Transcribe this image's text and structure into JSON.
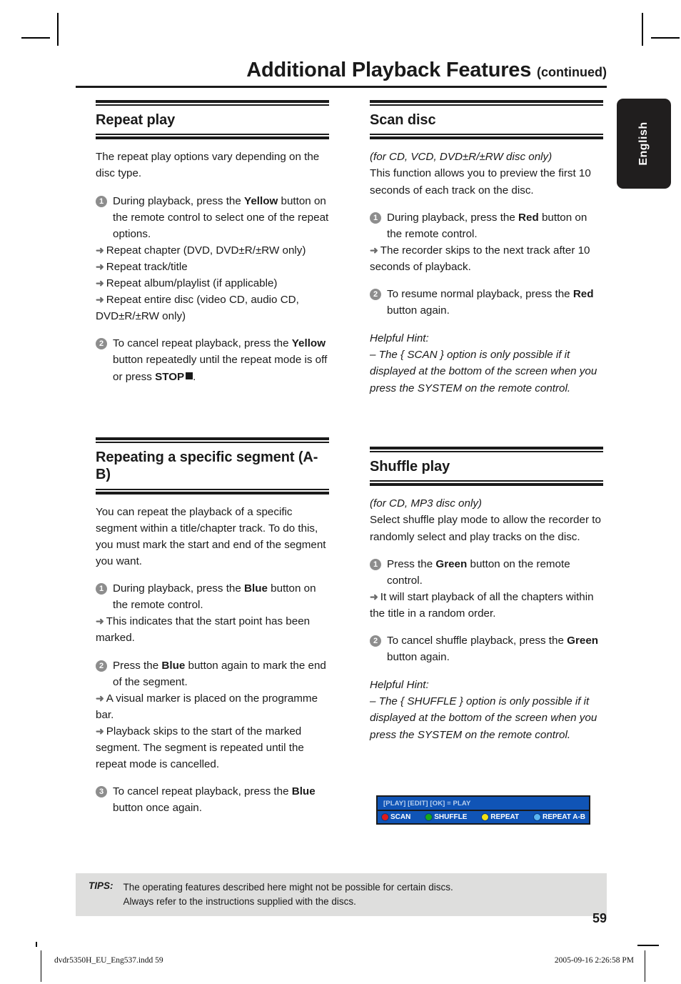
{
  "header": {
    "title_main": "Additional Playback Features",
    "title_suffix": "(continued)"
  },
  "language_tab": {
    "label": "English"
  },
  "left_column": {
    "sections": [
      {
        "heading": "Repeat play",
        "intro": "The repeat play options vary depending on the disc type.",
        "steps": [
          {
            "number": "1",
            "text_parts": [
              {
                "t": "During playback, press the ",
                "style": "normal"
              },
              {
                "t": "Yellow",
                "style": "bold"
              },
              {
                "t": " button on the remote control to select one of the repeat options.",
                "style": "normal"
              }
            ],
            "subs": [
              "Repeat chapter (DVD, DVD±R/±RW only)",
              "Repeat track/title",
              "Repeat album/playlist (if applicable)",
              "Repeat entire disc (video CD, audio CD, DVD±R/±RW only)"
            ]
          },
          {
            "number": "2",
            "text_parts": [
              {
                "t": "To cancel repeat playback, press the ",
                "style": "normal"
              },
              {
                "t": "Yellow",
                "style": "bold"
              },
              {
                "t": " button repeatedly until the repeat mode is off or press ",
                "style": "normal"
              },
              {
                "t": "STOP",
                "style": "bold"
              },
              {
                "t": "STOP_SQUARE",
                "style": "icon"
              },
              {
                "t": ".",
                "style": "normal"
              }
            ],
            "subs": []
          }
        ]
      },
      {
        "heading": "Repeating a specific segment (A-B)",
        "intro": "You can repeat the playback of a specific segment within a title/chapter track. To do this, you must mark the start and end of the segment you want.",
        "steps": [
          {
            "number": "1",
            "text_parts": [
              {
                "t": "During playback, press the ",
                "style": "normal"
              },
              {
                "t": "Blue",
                "style": "bold"
              },
              {
                "t": " button on the remote control.",
                "style": "normal"
              }
            ],
            "subs": [
              "This indicates that the start point has been marked."
            ]
          },
          {
            "number": "2",
            "text_parts": [
              {
                "t": "Press the ",
                "style": "normal"
              },
              {
                "t": "Blue",
                "style": "bold"
              },
              {
                "t": " button again to mark the end of the segment.",
                "style": "normal"
              }
            ],
            "subs": [
              "A visual marker is placed on the programme bar.",
              "Playback skips to the start of the marked segment. The segment is repeated until the repeat mode is cancelled."
            ]
          },
          {
            "number": "3",
            "text_parts": [
              {
                "t": "To cancel repeat playback, press the ",
                "style": "normal"
              },
              {
                "t": "Blue",
                "style": "bold"
              },
              {
                "t": " button once again.",
                "style": "normal"
              }
            ],
            "subs": []
          }
        ]
      }
    ]
  },
  "right_column": {
    "sections": [
      {
        "heading": "Scan disc",
        "disc_note": "(for CD, VCD, DVD±R/±RW disc only)",
        "intro": "This function allows you to preview the first 10 seconds of each track on the disc.",
        "steps": [
          {
            "number": "1",
            "text_parts": [
              {
                "t": "During playback, press the ",
                "style": "normal"
              },
              {
                "t": "Red",
                "style": "bold"
              },
              {
                "t": " button on the remote control.",
                "style": "normal"
              }
            ],
            "subs": [
              "The recorder skips to the next track after 10 seconds of playback."
            ]
          },
          {
            "number": "2",
            "text_parts": [
              {
                "t": "To resume normal playback, press the ",
                "style": "normal"
              },
              {
                "t": "Red",
                "style": "bold"
              },
              {
                "t": " button again.",
                "style": "normal"
              }
            ],
            "subs": []
          }
        ],
        "hint_label": "Helpful Hint:",
        "hint_text": "– The { SCAN } option is only possible if it displayed at the bottom of the screen when you press the SYSTEM on the remote control."
      },
      {
        "heading": "Shuffle play",
        "disc_note": "(for CD, MP3 disc only)",
        "intro": "Select shuffle play mode to allow the recorder to randomly select and play tracks on the disc.",
        "steps": [
          {
            "number": "1",
            "text_parts": [
              {
                "t": "Press the ",
                "style": "normal"
              },
              {
                "t": "Green",
                "style": "bold"
              },
              {
                "t": " button on the remote control.",
                "style": "normal"
              }
            ],
            "subs": [
              "It will start playback of all the chapters within the title in a random order."
            ]
          },
          {
            "number": "2",
            "text_parts": [
              {
                "t": "To cancel shuffle playback, press the ",
                "style": "normal"
              },
              {
                "t": "Green",
                "style": "bold"
              },
              {
                "t": " button again.",
                "style": "normal"
              }
            ],
            "subs": []
          }
        ],
        "hint_label": "Helpful Hint:",
        "hint_text": "– The { SHUFFLE } option is only possible if it displayed at the bottom of the screen when you press the SYSTEM on the remote control."
      }
    ]
  },
  "osd": {
    "background_color": "#1054b6",
    "status_line": "[PLAY] [EDIT] [OK] = PLAY",
    "buttons": [
      {
        "label": "SCAN",
        "color": "#e01b1b"
      },
      {
        "label": "SHUFFLE",
        "color": "#17a81a"
      },
      {
        "label": "REPEAT",
        "color": "#f2e014"
      },
      {
        "label": "REPEAT A-B",
        "color": "#5ab4f0"
      }
    ]
  },
  "tips": {
    "label": "TIPS:",
    "line1": "The operating features described here might not be possible for certain discs.",
    "line2": "Always refer to the instructions supplied with the discs."
  },
  "page_number": "59",
  "imprint": {
    "file": "dvdr5350H_EU_Eng537.indd   59",
    "date": "2005-09-16   2:26:58 PM"
  }
}
